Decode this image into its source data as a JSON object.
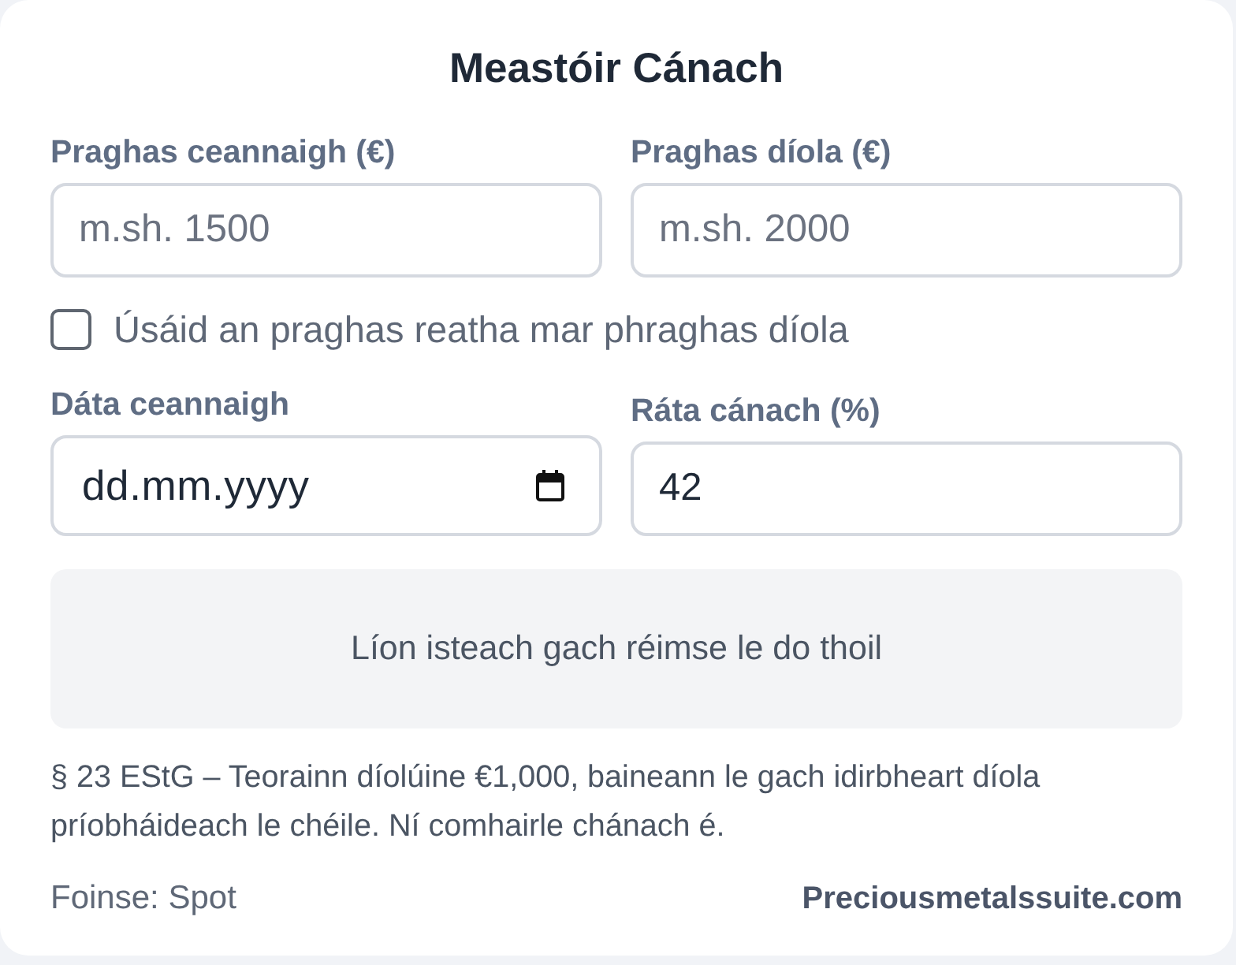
{
  "title": "Meastóir Cánach",
  "fields": [
    {
      "kind": "number",
      "label": "Praghas ceannaigh (€)",
      "placeholder": "m.sh. 1500"
    },
    {
      "kind": "number",
      "label": "Praghas díola (€)",
      "placeholder": "m.sh. 2000"
    },
    {
      "kind": "checkbox",
      "label": "Úsáid an praghas reatha mar phraghas díola",
      "checked": false
    },
    {
      "kind": "date",
      "label": "Dáta ceannaigh",
      "placeholder": "dd.mm.yyyy"
    },
    {
      "kind": "number",
      "label": "Ráta cánach (%)",
      "value": "42"
    }
  ],
  "status_message": "Líon isteach gach réimse le do thoil",
  "note": "§ 23 EStG – Teorainn díolúine €1,000, baineann le gach idirbheart díola príobháideach le chéile. Ní comhairle chánach é.",
  "footer": {
    "source": "Foinse: Spot",
    "brand": "Preciousmetalssuite.com"
  }
}
